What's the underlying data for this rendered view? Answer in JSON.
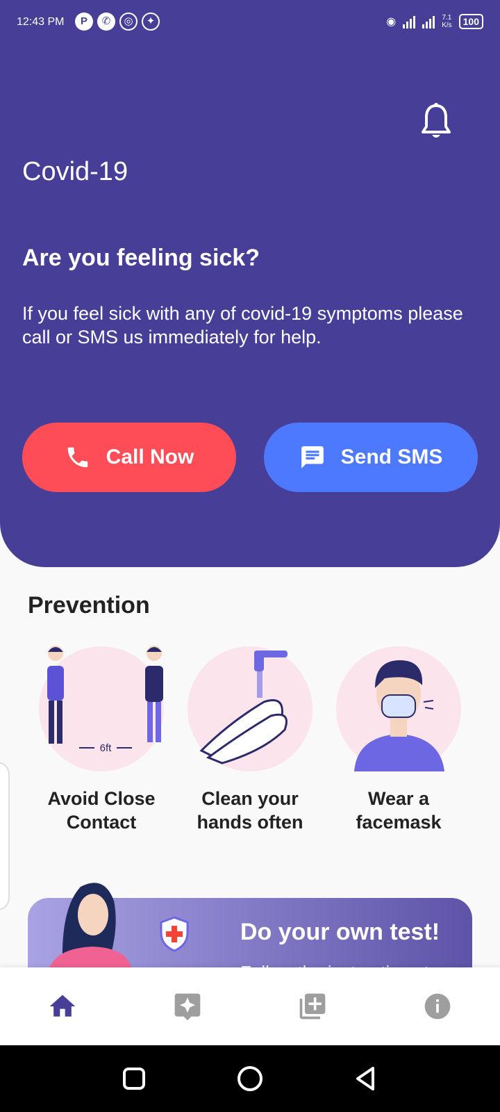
{
  "status_bar": {
    "time": "12:43 PM",
    "app_icons": [
      "P",
      "phone-icon",
      "airdrop-icon",
      "browser-icon"
    ],
    "net_speed": "7.1\nK/s",
    "battery": "100"
  },
  "header": {
    "title": "Covid-19",
    "question": "Are you feeling sick?",
    "description": "If you feel sick with any of covid-19 symptoms please call or SMS us immediately for help.",
    "call_button": "Call Now",
    "sms_button": "Send SMS",
    "colors": {
      "background": "#473F97",
      "call": "#FF4D58",
      "sms": "#4D79FF"
    }
  },
  "prevention": {
    "title": "Prevention",
    "items": [
      {
        "label": "Avoid Close Contact",
        "icon": "distance-illustration",
        "distance": "6ft"
      },
      {
        "label": "Clean your hands often",
        "icon": "handwash-illustration"
      },
      {
        "label": "Wear a facemask",
        "icon": "facemask-illustration"
      }
    ]
  },
  "promo": {
    "title": "Do your own test!",
    "subtitle": "Follow the instructions to"
  },
  "bottom_nav": [
    "home-icon",
    "sparkle-icon",
    "library-add-icon",
    "info-icon"
  ]
}
